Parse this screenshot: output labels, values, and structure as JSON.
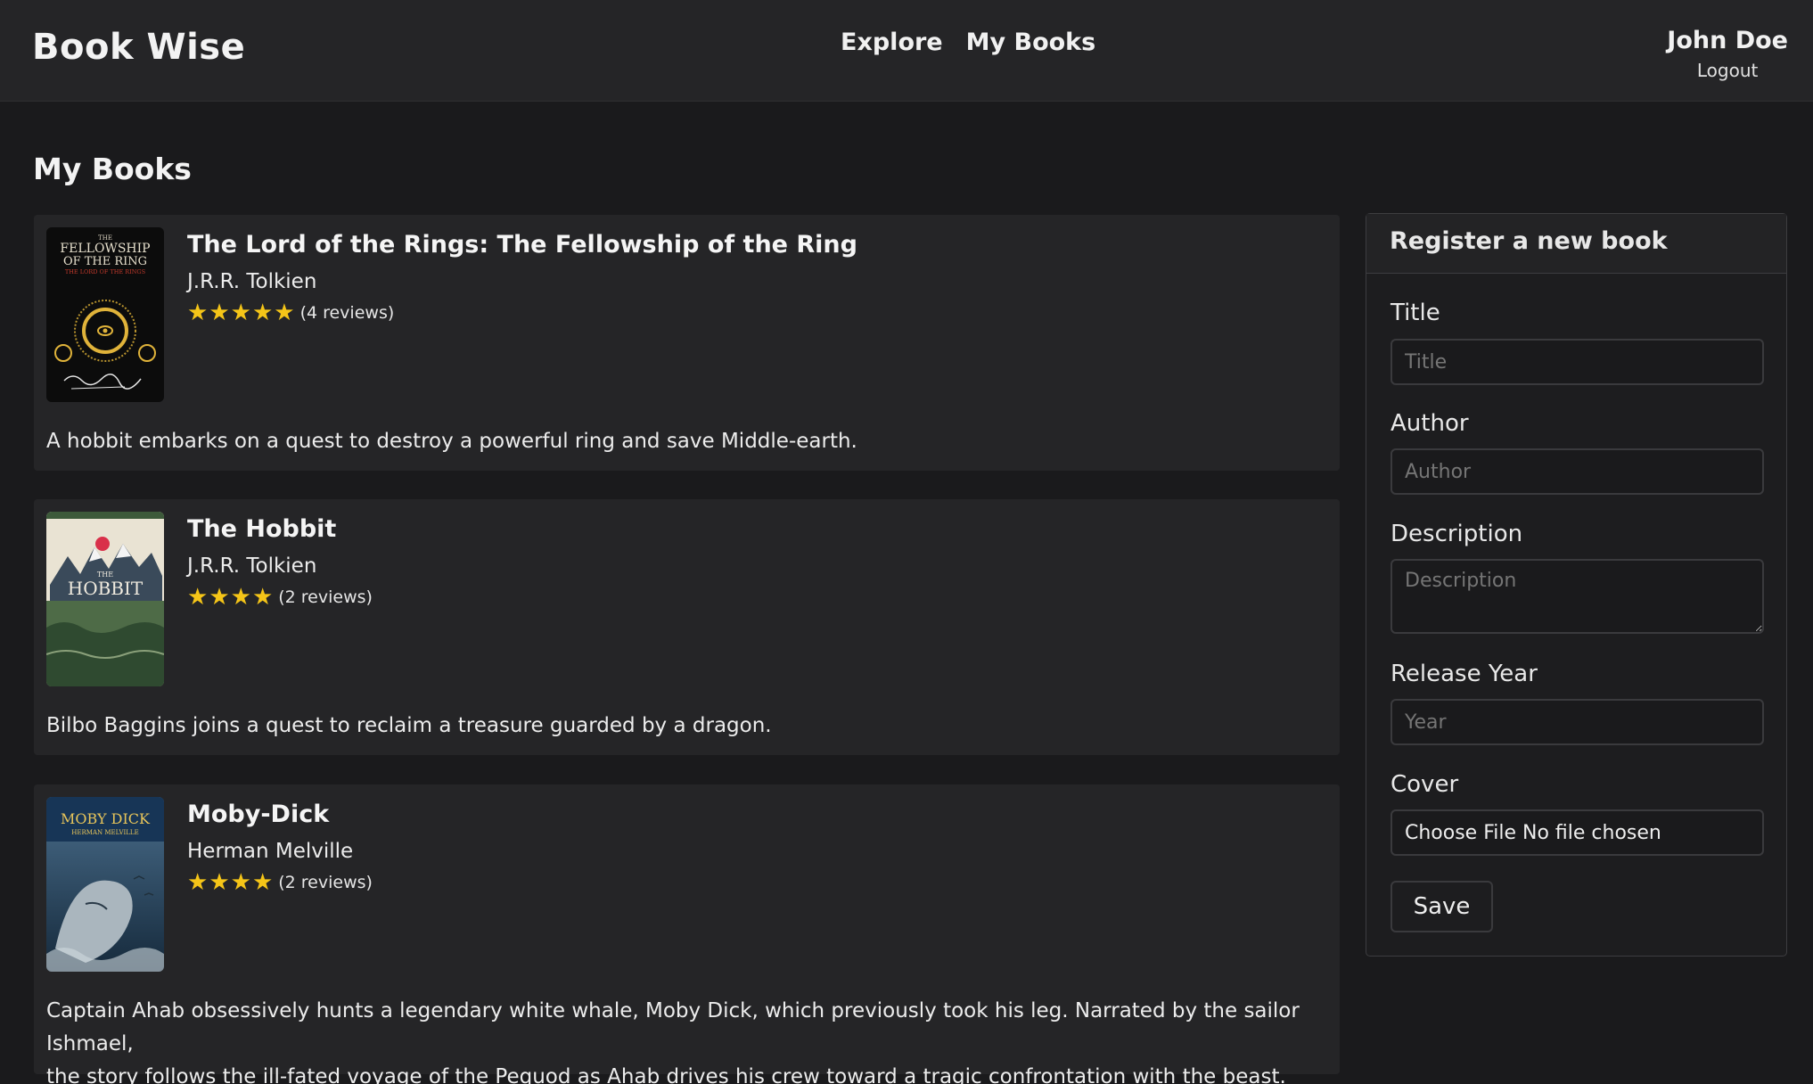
{
  "header": {
    "brand": "Book Wise",
    "nav": [
      {
        "label": "Explore"
      },
      {
        "label": "My Books"
      }
    ],
    "user_name": "John Doe",
    "logout_label": "Logout"
  },
  "page": {
    "title": "My Books"
  },
  "books": [
    {
      "title": "The Lord of the Rings: The Fellowship of the Ring",
      "author": "J.R.R. Tolkien",
      "rating": 5,
      "reviews": "(4 reviews)",
      "description": "A hobbit embarks on a quest to destroy a powerful ring and save Middle-earth.",
      "cover_line1": "THE",
      "cover_line2": "FELLOWSHIP",
      "cover_line3": "OF THE RING",
      "cover_line4": "THE LORD OF THE RINGS"
    },
    {
      "title": "The Hobbit",
      "author": "J.R.R. Tolkien",
      "rating": 4,
      "reviews": "(2 reviews)",
      "description": "Bilbo Baggins joins a quest to reclaim a treasure guarded by a dragon.",
      "cover_line1": "THE",
      "cover_line2": "HOBBIT"
    },
    {
      "title": "Moby-Dick",
      "author": "Herman Melville",
      "rating": 4,
      "reviews": "(2 reviews)",
      "description_line1": "Captain Ahab obsessively hunts a legendary white whale, Moby Dick, which previously took his leg. Narrated by the sailor Ishmael,",
      "description_line2": "the story follows the ill-fated voyage of the Pequod as Ahab drives his crew toward a tragic confrontation with the beast.",
      "cover_line1": "MOBY DICK",
      "cover_line2": "HERMAN MELVILLE"
    }
  ],
  "form": {
    "heading": "Register a new book",
    "title_label": "Title",
    "title_placeholder": "Title",
    "author_label": "Author",
    "author_placeholder": "Author",
    "description_label": "Description",
    "description_placeholder": "Description",
    "year_label": "Release Year",
    "year_placeholder": "Year",
    "cover_label": "Cover",
    "file_text": "Choose File No file chosen",
    "save_label": "Save"
  },
  "colors": {
    "background": "#1a1a1c",
    "card": "#252527",
    "star": "#f5c518"
  }
}
